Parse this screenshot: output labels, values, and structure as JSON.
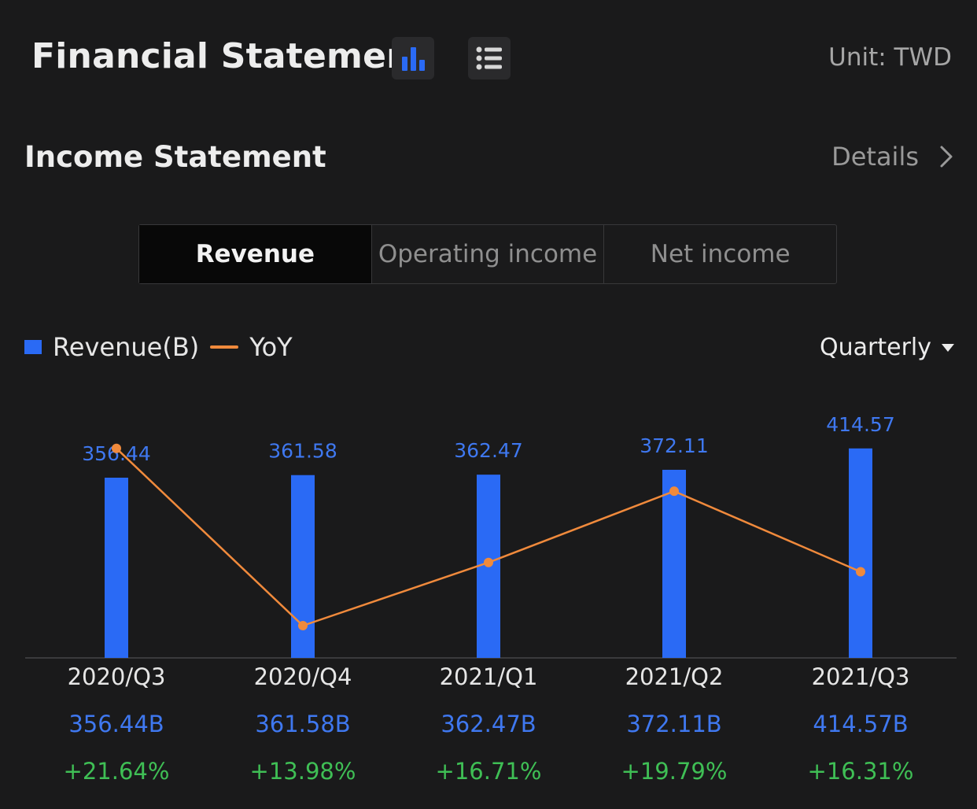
{
  "header": {
    "title": "Financial Statement",
    "unit": "Unit: TWD",
    "chart_icon": "bar-chart-icon",
    "list_icon": "list-icon"
  },
  "section": {
    "title": "Income Statement",
    "details_label": "Details"
  },
  "tabs": [
    {
      "label": "Revenue",
      "active": true
    },
    {
      "label": "Operating income",
      "active": false
    },
    {
      "label": "Net income",
      "active": false
    }
  ],
  "legend": {
    "bar_label": "Revenue(B)",
    "line_label": "YoY"
  },
  "period": {
    "selected": "Quarterly"
  },
  "colors": {
    "bar": "#2a6af5",
    "line": "#f08a3c",
    "value_text": "#3f78f0",
    "positive": "#3fbf55"
  },
  "chart_data": {
    "type": "bar",
    "categories": [
      "2020/Q3",
      "2020/Q4",
      "2021/Q1",
      "2021/Q2",
      "2021/Q3"
    ],
    "series": [
      {
        "name": "Revenue(B)",
        "type": "bar",
        "values": [
          356.44,
          361.58,
          362.47,
          372.11,
          414.57
        ]
      },
      {
        "name": "YoY",
        "type": "line",
        "values": [
          21.64,
          13.98,
          16.71,
          19.79,
          16.31
        ]
      }
    ],
    "bar_labels": [
      "356.44",
      "361.58",
      "362.47",
      "372.11",
      "414.57"
    ]
  },
  "table": {
    "values": [
      "356.44B",
      "361.58B",
      "362.47B",
      "372.11B",
      "414.57B"
    ],
    "yoy": [
      "+21.64%",
      "+13.98%",
      "+16.71%",
      "+19.79%",
      "+16.31%"
    ]
  }
}
